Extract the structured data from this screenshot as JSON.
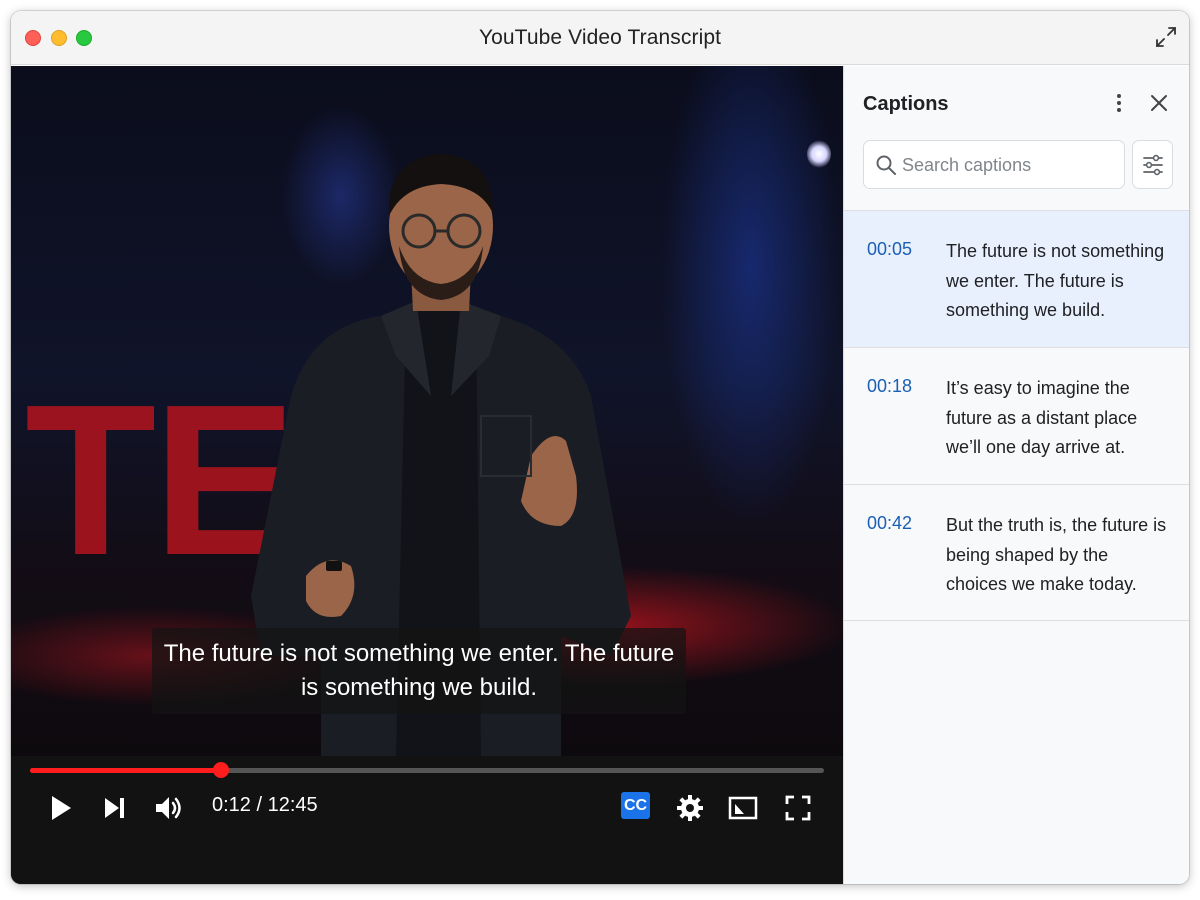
{
  "window": {
    "title": "YouTube Video Transcript"
  },
  "player": {
    "subtitle": "The future is not something we enter. The future is something we build.",
    "current_time": "0:12",
    "duration": "12:45",
    "time_display": "0:12 / 12:45",
    "progress_fraction": 0.24,
    "cc_label": "CC",
    "colors": {
      "progress": "#ff1d1d",
      "cc_badge": "#1a73e8"
    },
    "icons": [
      "play-icon",
      "next-icon",
      "volume-icon",
      "gear-icon",
      "miniplayer-icon",
      "fullscreen-icon"
    ]
  },
  "panel": {
    "title": "Captions",
    "search_placeholder": "Search captions",
    "captions": [
      {
        "time": "00:05",
        "text": "The future is not something we enter. The future is something we build.",
        "active": true
      },
      {
        "time": "00:18",
        "text": "It’s easy to imagine the future as a distant place we’ll one day arrive at.",
        "active": false
      },
      {
        "time": "00:42",
        "text": "But the truth is, the future is being shaped by the choices we make today.",
        "active": false
      }
    ],
    "colors": {
      "timestamp": "#1a5fb4",
      "active_row": "#e8f0fe"
    }
  }
}
